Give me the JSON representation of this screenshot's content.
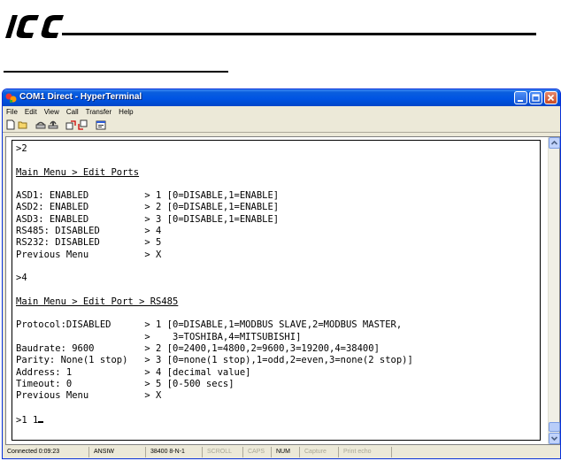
{
  "document": {
    "logo_text": "ICC"
  },
  "window": {
    "title": "COM1 Direct - HyperTerminal",
    "icon": "hyperterminal-icon",
    "controls": [
      "minimize-icon",
      "maximize-icon",
      "close-icon"
    ]
  },
  "menu": {
    "items": [
      "File",
      "Edit",
      "View",
      "Call",
      "Transfer",
      "Help"
    ]
  },
  "toolbar": {
    "icons": [
      "new-icon",
      "open-icon",
      "call-icon",
      "disconnect-icon",
      "send-icon",
      "receive-icon",
      "properties-icon"
    ]
  },
  "terminal": {
    "lines": [
      {
        "text": ">2",
        "underline": false
      },
      {
        "text": "",
        "underline": false
      },
      {
        "text": "Main Menu > Edit Ports",
        "underline": true
      },
      {
        "text": "",
        "underline": false
      },
      {
        "text": "ASD1: ENABLED          > 1 [0=DISABLE,1=ENABLE]",
        "underline": false
      },
      {
        "text": "ASD2: ENABLED          > 2 [0=DISABLE,1=ENABLE]",
        "underline": false
      },
      {
        "text": "ASD3: ENABLED          > 3 [0=DISABLE,1=ENABLE]",
        "underline": false
      },
      {
        "text": "RS485: DISABLED        > 4",
        "underline": false
      },
      {
        "text": "RS232: DISABLED        > 5",
        "underline": false
      },
      {
        "text": "Previous Menu          > X",
        "underline": false
      },
      {
        "text": "",
        "underline": false
      },
      {
        "text": ">4",
        "underline": false
      },
      {
        "text": "",
        "underline": false
      },
      {
        "text": "Main Menu > Edit Port > RS485",
        "underline": true
      },
      {
        "text": "",
        "underline": false
      },
      {
        "text": "Protocol:DISABLED      > 1 [0=DISABLE,1=MODBUS SLAVE,2=MODBUS MASTER,",
        "underline": false
      },
      {
        "text": "                       >    3=TOSHIBA,4=MITSUBISHI]",
        "underline": false
      },
      {
        "text": "Baudrate: 9600         > 2 [0=2400,1=4800,2=9600,3=19200,4=38400]",
        "underline": false
      },
      {
        "text": "Parity: None(1 stop)   > 3 [0=none(1 stop),1=odd,2=even,3=none(2 stop)]",
        "underline": false
      },
      {
        "text": "Address: 1             > 4 [decimal value]",
        "underline": false
      },
      {
        "text": "Timeout: 0             > 5 [0-500 secs]",
        "underline": false
      },
      {
        "text": "Previous Menu          > X",
        "underline": false
      },
      {
        "text": "",
        "underline": false
      },
      {
        "text": ">1 1",
        "underline": false
      }
    ]
  },
  "status": {
    "connected": "Connected 0:09:23",
    "emulation": "ANSIW",
    "port_settings": "38400 8-N-1",
    "scroll": "SCROLL",
    "caps": "CAPS",
    "num": "NUM",
    "capture": "Capture",
    "print_echo": "Print echo"
  },
  "colors": {
    "titlebar": "#0054e3",
    "window_bg": "#ece9d8",
    "terminal_bg": "#ffffff",
    "terminal_text": "#000000"
  }
}
